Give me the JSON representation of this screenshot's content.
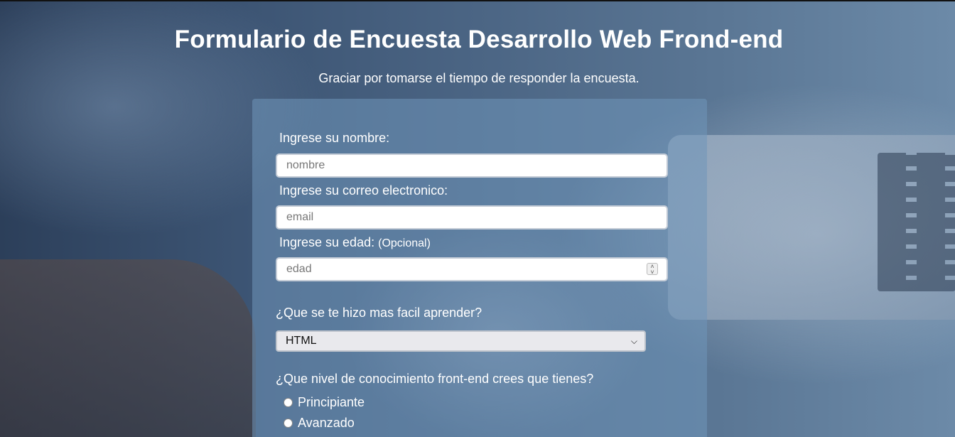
{
  "header": {
    "title": "Formulario de Encuesta Desarrollo Web Frond-end",
    "description": "Graciar por tomarse el tiempo de responder la encuesta."
  },
  "form": {
    "name": {
      "label": "Ingrese su nombre:",
      "placeholder": "nombre",
      "value": ""
    },
    "email": {
      "label": "Ingrese su correo electronico:",
      "placeholder": "email",
      "value": ""
    },
    "age": {
      "label": "Ingrese su edad:",
      "optional_note": "(Opcional)",
      "placeholder": "edad",
      "value": ""
    },
    "easiest": {
      "question": "¿Que se te hizo mas facil aprender?",
      "selected": "HTML"
    },
    "level": {
      "question": "¿Que nivel de conocimiento front-end crees que tienes?",
      "options": [
        "Principiante",
        "Avanzado"
      ]
    }
  },
  "icons": {
    "spinner": "number-spinner-icon",
    "dropdown": "chevron-down-icon",
    "radio": "radio-unchecked-icon"
  },
  "colors": {
    "card_overlay": "#7096b9",
    "text": "#ffffff",
    "select_bg": "#e9e9ed"
  }
}
